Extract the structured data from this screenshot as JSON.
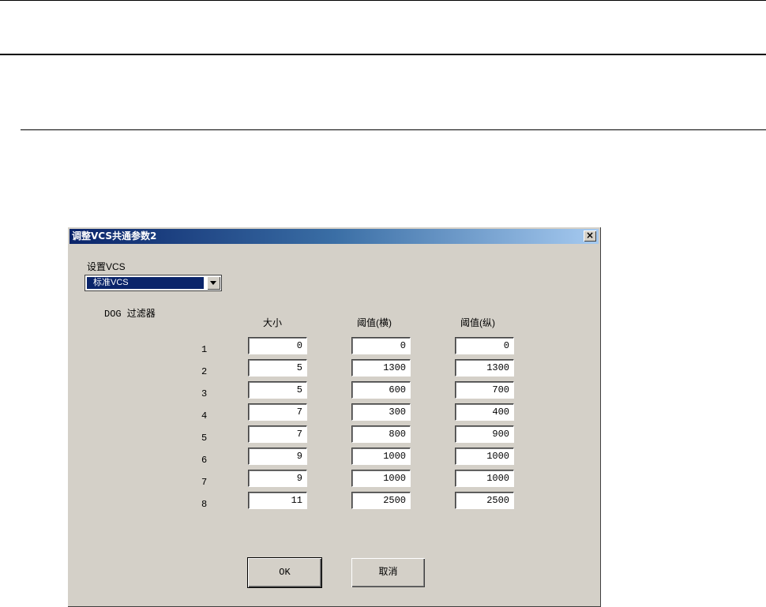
{
  "dialog": {
    "title": "调整VCS共通参数2",
    "close_label": "×",
    "vcs_label": "设置VCS",
    "vcs_select_value": "标准VCS",
    "dog_label": "DOG 过滤器",
    "columns": [
      "大小",
      "阈值(横)",
      "阈值(纵)"
    ],
    "rows": [
      {
        "num": "1",
        "size": "0",
        "thr_h": "0",
        "thr_v": "0"
      },
      {
        "num": "2",
        "size": "5",
        "thr_h": "1300",
        "thr_v": "1300"
      },
      {
        "num": "3",
        "size": "5",
        "thr_h": "600",
        "thr_v": "700"
      },
      {
        "num": "4",
        "size": "7",
        "thr_h": "300",
        "thr_v": "400"
      },
      {
        "num": "5",
        "size": "7",
        "thr_h": "800",
        "thr_v": "900"
      },
      {
        "num": "6",
        "size": "9",
        "thr_h": "1000",
        "thr_v": "1000"
      },
      {
        "num": "7",
        "size": "9",
        "thr_h": "1000",
        "thr_v": "1000"
      },
      {
        "num": "8",
        "size": "11",
        "thr_h": "2500",
        "thr_v": "2500"
      }
    ],
    "ok_label": "OK",
    "cancel_label": "取消"
  }
}
